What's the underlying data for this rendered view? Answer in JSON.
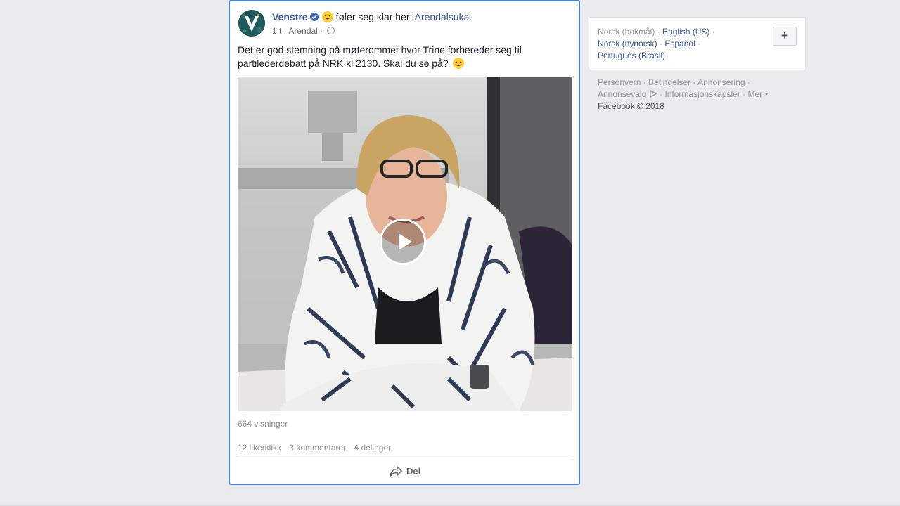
{
  "post": {
    "page_name": "Venstre",
    "activity_text": "føler seg klar her:",
    "activity_place": "Arendalsuka.",
    "time": "1 t",
    "separator": "·",
    "location": "Arendal",
    "body_line1": "Det er god stemning på møterommet hvor Trine forbereder seg til",
    "body_line2": "partilederdebatt på NRK kl 2130. Skal du se på?",
    "views": "664 visninger",
    "likes": "12 likerklikk",
    "comments": "3 kommentarer",
    "shares": "4 delinger",
    "share_label": "Del"
  },
  "languages": {
    "current": "Norsk (bokmål)",
    "options": [
      "English (US)",
      "Norsk (nynorsk)",
      "Español",
      "Português (Brasil)"
    ],
    "add_label": "+"
  },
  "footer": {
    "links": [
      "Personvern",
      "Betingelser",
      "Annonsering",
      "Annonsevalg",
      "Informasjonskapsler",
      "Mer"
    ],
    "copyright": "Facebook © 2018"
  },
  "colors": {
    "link": "#385898",
    "focus_border": "#4a7fd6",
    "background": "#e9ebee"
  }
}
